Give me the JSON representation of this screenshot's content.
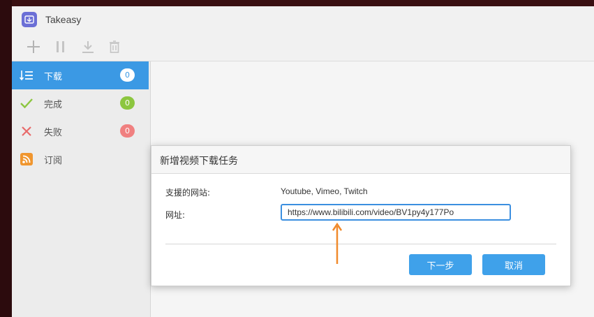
{
  "app": {
    "title": "Takeasy"
  },
  "toolbar": {
    "icons": [
      "add-icon",
      "pause-icon",
      "download-icon",
      "delete-icon"
    ]
  },
  "sidebar": {
    "items": [
      {
        "label": "下载",
        "count": "0",
        "icon": "download-list-icon",
        "active": true,
        "badge_color": "#ffffff"
      },
      {
        "label": "完成",
        "count": "0",
        "icon": "check-icon",
        "active": false,
        "badge_color": "#8cc63f"
      },
      {
        "label": "失败",
        "count": "0",
        "icon": "close-icon",
        "active": false,
        "badge_color": "#f08080"
      },
      {
        "label": "订阅",
        "icon": "rss-icon",
        "active": false
      }
    ]
  },
  "dialog": {
    "title": "新增视频下载任务",
    "supported_label": "支援的网站:",
    "supported_value": "Youtube, Vimeo, Twitch",
    "url_label": "网址:",
    "url_value": "https://www.bilibili.com/video/BV1py4y177Po",
    "next_button": "下一步",
    "cancel_button": "取消"
  },
  "colors": {
    "accent": "#3b99e4",
    "button": "#3fa1ea",
    "annotation_arrow": "#f08a2c"
  }
}
